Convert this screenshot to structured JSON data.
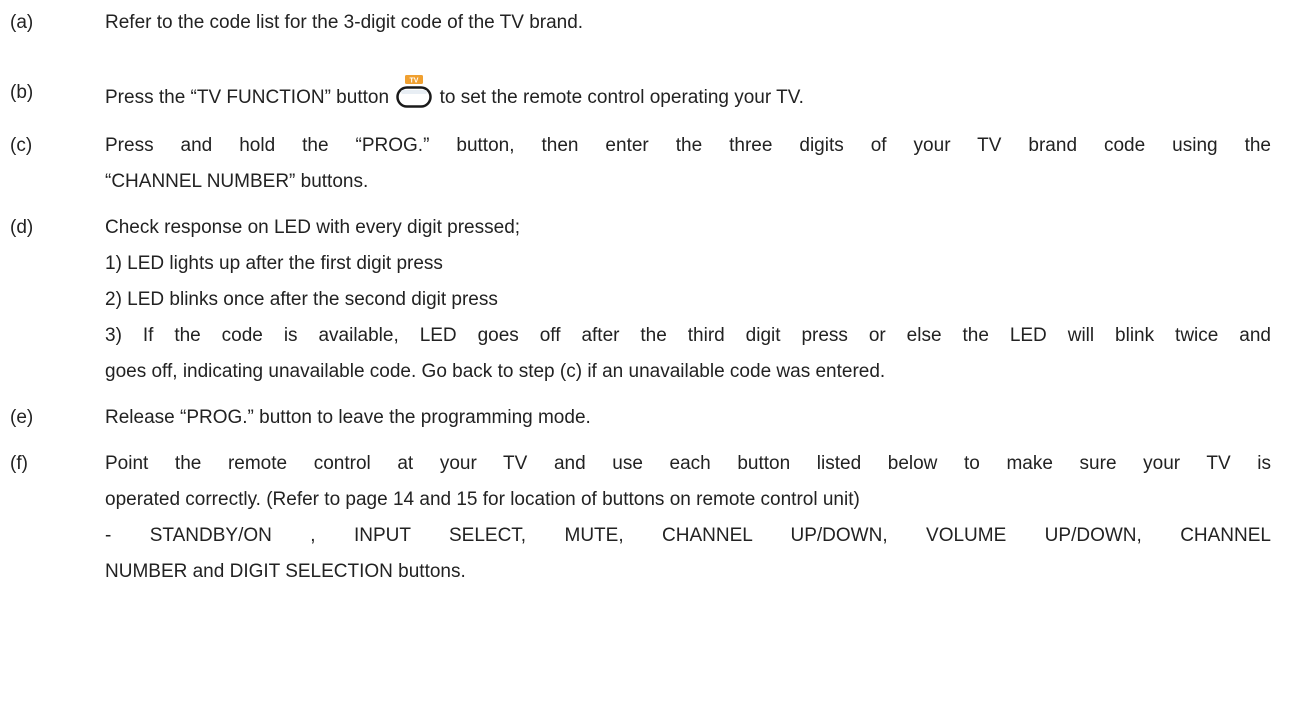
{
  "steps": [
    {
      "marker": "(a)",
      "text": "Refer to the code list for the 3-digit code of the TV brand."
    },
    {
      "marker": "(b)",
      "text_before": "Press the “TV FUNCTION” button",
      "icon": "tv-function-button-icon",
      "icon_label": "TV",
      "text_after": "to set the remote control operating your TV."
    },
    {
      "marker": "(c)",
      "line1": "Press and hold the “PROG.” button, then enter the three digits of your TV brand code using the",
      "line2": "“CHANNEL NUMBER” buttons."
    },
    {
      "marker": "(d)",
      "text": "Check response on LED with every digit pressed;",
      "sub": [
        "1) LED lights up after the first digit press",
        "2) LED blinks once after the second digit press"
      ],
      "sub3_line1": "3) If the code is available, LED goes off after the third digit press or else the LED will blink twice and",
      "sub3_line2": "goes off, indicating unavailable code. Go back to step (c) if an unavailable code was entered."
    },
    {
      "marker": "(e)",
      "text": "Release “PROG.” button to leave the programming mode."
    },
    {
      "marker": "(f)",
      "line1": "Point the remote control at your TV and use each button listed below to make sure your TV is",
      "line2": "operated correctly. (Refer to page 14 and 15 for location of buttons on remote control unit)",
      "line3": "- STANDBY/ON , INPUT SELECT, MUTE, CHANNEL UP/DOWN, VOLUME UP/DOWN, CHANNEL",
      "line4": "NUMBER and DIGIT SELECTION buttons."
    }
  ],
  "colors": {
    "text": "#222222",
    "icon_orange": "#f0a030",
    "icon_outline": "#1a1a1a"
  }
}
